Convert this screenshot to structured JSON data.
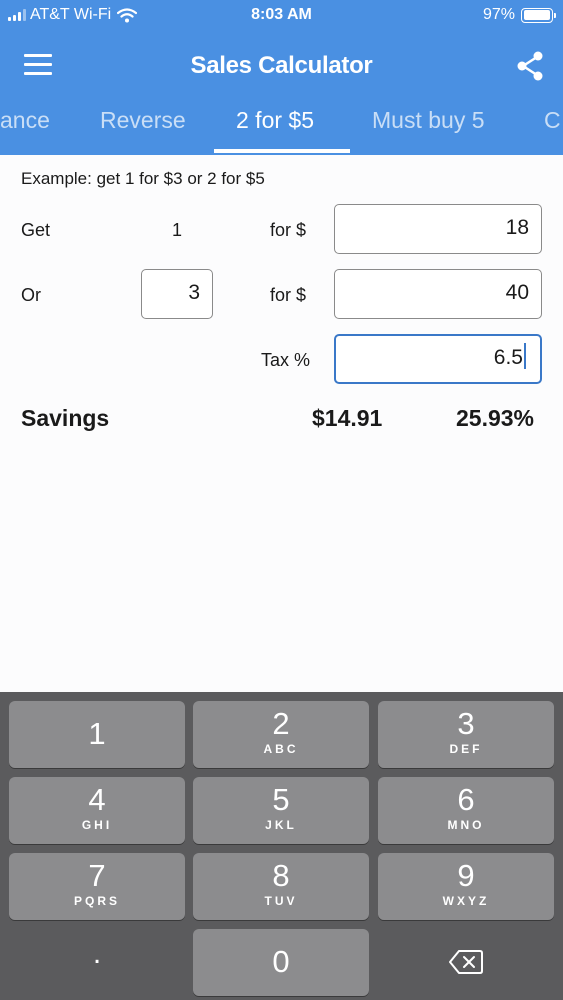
{
  "status": {
    "carrier": "AT&T Wi-Fi",
    "time": "8:03 AM",
    "battery": "97%",
    "battery_level": 0.97
  },
  "header": {
    "title": "Sales Calculator"
  },
  "tabs": [
    {
      "label": "ance"
    },
    {
      "label": "Reverse"
    },
    {
      "label": "2 for $5",
      "active": true
    },
    {
      "label": "Must buy 5"
    },
    {
      "label": "C"
    }
  ],
  "form": {
    "example": "Example: get 1 for $3 or 2 for $5",
    "get_label": "Get",
    "get_qty": "1",
    "for_label_1": "for $",
    "price_1": "18",
    "or_label": "Or",
    "or_qty": "3",
    "for_label_2": "for $",
    "price_2": "40",
    "tax_label": "Tax %",
    "tax_value": "6.5"
  },
  "savings": {
    "label": "Savings",
    "amount": "$14.91",
    "percent": "25.93%"
  },
  "keypad": {
    "keys": [
      {
        "digit": "1",
        "letters": ""
      },
      {
        "digit": "2",
        "letters": "ABC"
      },
      {
        "digit": "3",
        "letters": "DEF"
      },
      {
        "digit": "4",
        "letters": "GHI"
      },
      {
        "digit": "5",
        "letters": "JKL"
      },
      {
        "digit": "6",
        "letters": "MNO"
      },
      {
        "digit": "7",
        "letters": "PQRS"
      },
      {
        "digit": "8",
        "letters": "TUV"
      },
      {
        "digit": "9",
        "letters": "WXYZ"
      },
      {
        "digit": "0",
        "letters": ""
      }
    ],
    "decimal": ".",
    "backspace_icon": "backspace-icon"
  },
  "colors": {
    "header": "#4a90e2",
    "focus": "#3a78c8"
  }
}
